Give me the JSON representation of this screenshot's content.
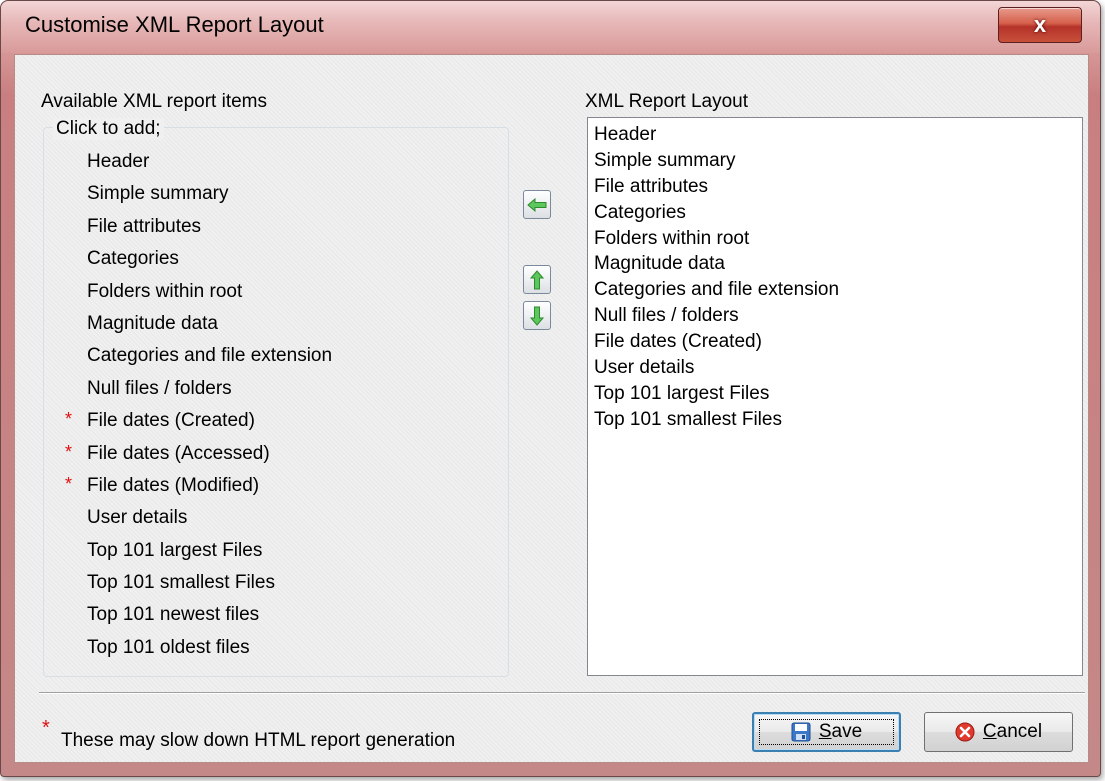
{
  "window": {
    "title": "Customise XML Report Layout",
    "close_label": "x"
  },
  "available": {
    "heading": "Available XML report items",
    "group_label": "Click to add;",
    "items": [
      {
        "label": "Header",
        "star": ""
      },
      {
        "label": "Simple summary",
        "star": ""
      },
      {
        "label": "File attributes",
        "star": ""
      },
      {
        "label": "Categories",
        "star": ""
      },
      {
        "label": "Folders within root",
        "star": ""
      },
      {
        "label": "Magnitude data",
        "star": ""
      },
      {
        "label": "Categories and file extension",
        "star": ""
      },
      {
        "label": "Null files / folders",
        "star": ""
      },
      {
        "label": "File dates (Created)",
        "star": "*"
      },
      {
        "label": "File dates (Accessed)",
        "star": "*"
      },
      {
        "label": "File dates (Modified)",
        "star": "*"
      },
      {
        "label": "User details",
        "star": ""
      },
      {
        "label": "Top 101 largest Files",
        "star": ""
      },
      {
        "label": "Top 101 smallest Files",
        "star": ""
      },
      {
        "label": "Top 101 newest files",
        "star": ""
      },
      {
        "label": "Top 101 oldest files",
        "star": ""
      }
    ]
  },
  "layout": {
    "heading": "XML Report Layout",
    "items": [
      "Header",
      "Simple summary",
      "File attributes",
      "Categories",
      "Folders within root",
      "Magnitude data",
      "Categories and file extension",
      "Null files / folders",
      "File dates (Created)",
      "User details",
      "Top 101 largest Files",
      "Top 101 smallest Files"
    ]
  },
  "footnote": {
    "star": "*",
    "text": "These may slow down HTML report generation"
  },
  "buttons": {
    "save_underline": "S",
    "save_rest": "ave",
    "cancel_underline": "C",
    "cancel_rest": "ancel"
  },
  "icons": {
    "remove": "arrow-left-icon",
    "move_up": "arrow-up-icon",
    "move_down": "arrow-down-icon",
    "save": "floppy-disk-icon",
    "cancel": "cancel-icon"
  },
  "colors": {
    "title_bar": "#d99a9a",
    "close_button": "#c8503a",
    "star": "#e01010",
    "arrow": "#3fae3f",
    "default_button_border": "#3c7fb1"
  }
}
